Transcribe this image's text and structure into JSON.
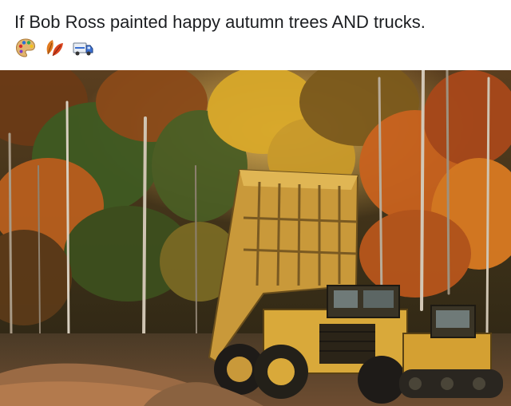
{
  "post": {
    "caption": "If Bob Ross painted happy autumn trees AND trucks.",
    "emojis": [
      "palette-icon",
      "autumn-leaves-icon",
      "truck-icon"
    ]
  },
  "photo": {
    "subject": "photo-dump-truck-autumn-forest",
    "colors": {
      "foliage_orange": "#c8621e",
      "foliage_yellow": "#d8a82a",
      "foliage_green": "#3f5a22",
      "truck_yellow": "#d9a93a",
      "dirt": "#8a6240"
    }
  }
}
